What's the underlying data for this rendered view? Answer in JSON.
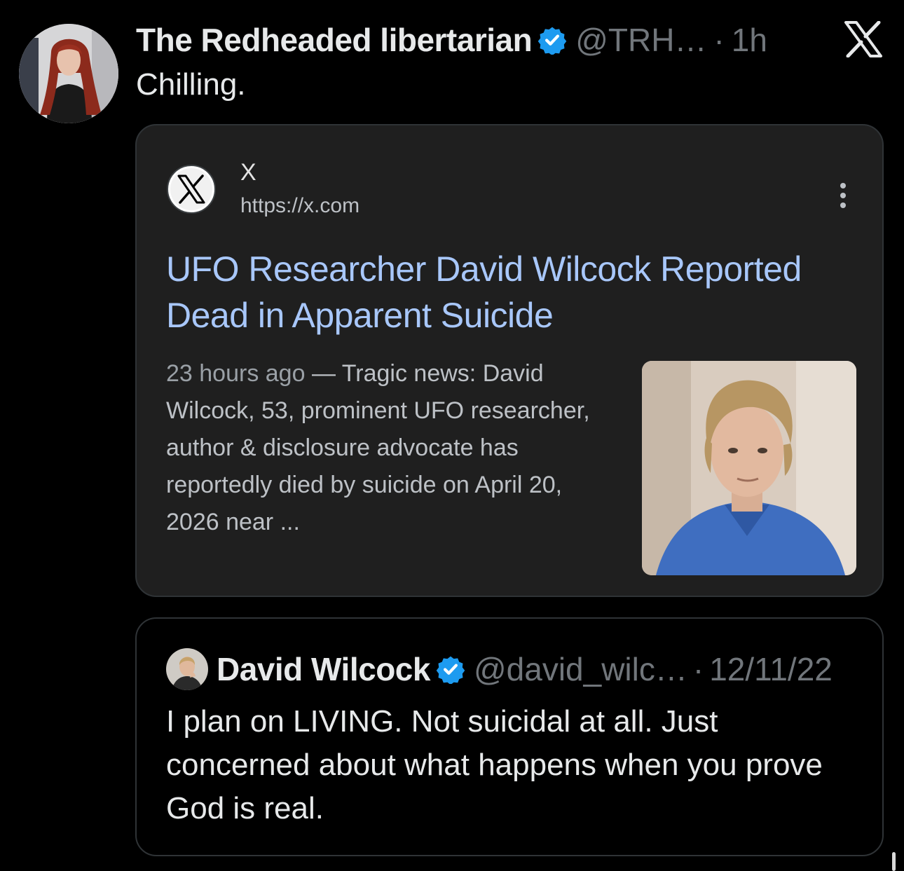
{
  "post": {
    "author_name": "The Redheaded libertarian",
    "handle": "@TRH…",
    "separator": "·",
    "time": "1h",
    "text": "Chilling."
  },
  "search_card": {
    "site_name": "X",
    "site_url": "https://x.com",
    "title": "UFO Researcher David Wilcock Reported Dead in Apparent Suicide",
    "date": "23 hours ago",
    "snippet_separator": " — ",
    "snippet": "Tragic news: David Wilcock, 53, prominent UFO researcher, author & disclosure advocate has reportedly died by suicide on April 20, 2026 near ..."
  },
  "quoted_post": {
    "author_name": "David Wilcock",
    "handle": "@david_wilc…",
    "separator": "·",
    "date": "12/11/22",
    "text": "I plan on LIVING. Not suicidal at all. Just concerned about what happens when you prove God is real."
  },
  "icons": {
    "verified": "verified-badge-icon",
    "x_logo": "x-logo-icon",
    "more": "more-vertical-icon"
  },
  "colors": {
    "background": "#000000",
    "text_primary": "#e7e9ea",
    "text_secondary": "#71767b",
    "verified_blue": "#1d9bf0",
    "link_blue": "#a8c7fa",
    "card_background": "#1f1f1f"
  }
}
